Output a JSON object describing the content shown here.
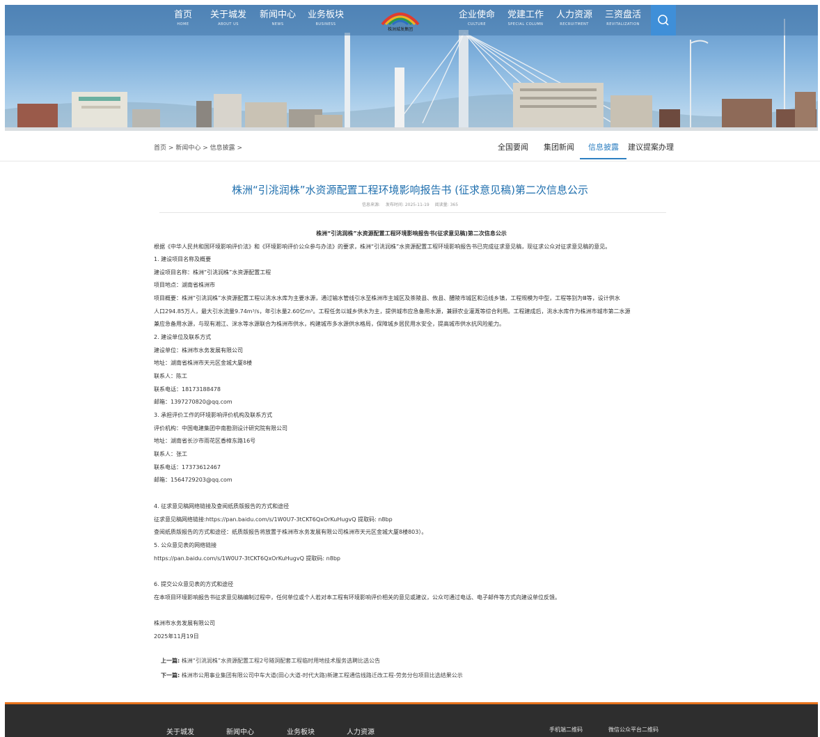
{
  "nav": {
    "items": [
      {
        "zh": "首页",
        "en": "HOME"
      },
      {
        "zh": "关于城发",
        "en": "ABOUT US"
      },
      {
        "zh": "新闻中心",
        "en": "NEWS"
      },
      {
        "zh": "业务板块",
        "en": "BUSINESS"
      },
      {
        "zh": "企业使命",
        "en": "CULTURE"
      },
      {
        "zh": "党建工作",
        "en": "SPECIAL COLUMN"
      },
      {
        "zh": "人力资源",
        "en": "RECRUITMENT"
      },
      {
        "zh": "三资盘活",
        "en": "REVITALIZATION"
      }
    ],
    "logo_text": "株洲城发集团"
  },
  "breadcrumb": {
    "home": "首页",
    "sep": ">",
    "news": "新闻中心",
    "current": "信息披露"
  },
  "tabs": [
    "全国要闻",
    "集团新闻",
    "信息披露",
    "建议提案办理"
  ],
  "article": {
    "title": "株洲“引洮润株”水资源配置工程环境影响报告书 (征求意见稿)第二次信息公示",
    "meta": {
      "source": "信息来源:",
      "date": "发布时间: 2025-11-19",
      "views": "阅读量: 365"
    },
    "heading": "株洲“引洮润株”水资源配置工程环境影响报告书(征求意见稿)第二次信息公示",
    "lines": [
      "根据《中华人民共和国环境影响评价法》和《环境影响评价公众参与办法》的要求，株洲“引洮润株”水资源配置工程环境影响报告书已完成征求意见稿，现征求公众对征求意见稿的意见。",
      "1. 建设项目名称及概要",
      "建设项目名称：株洲“引洮润株”水资源配置工程",
      "项目地点：湖南省株洲市",
      "项目概要：株洲“引洮润株”水资源配置工程以洮水水库为主要水源，通过输水管线引水至株洲市主城区及茶陵县、攸县、醴陵市城区和沿线乡镇，工程规模为中型，工程等别为Ⅲ等，设计供水",
      "人口294.85万人，最大引水流量9.74m³/s，年引水量2.60亿m³。工程任务以城乡供水为主，提供城市应急备用水源，兼顾农业灌溉等综合利用。工程建成后，洮水水库作为株洲市城市第二水源",
      "兼应急备用水源，与现有湘江、洣水等水源联合为株洲市供水，构建城市多水源供水格局，保障城乡居民用水安全，提高城市供水抗风险能力。",
      "2. 建设单位及联系方式",
      "建设单位：株洲市水务发展有限公司",
      "地址：湖南省株洲市天元区金城大厦8楼",
      "联系人：陈工",
      "联系电话：18173188478",
      "邮箱：1397270820@qq.com",
      "3. 承担评价工作的环境影响评价机构及联系方式",
      "评价机构：中国电建集团中南勘测设计研究院有限公司",
      "地址：湖南省长沙市雨花区香樟东路16号",
      "联系人：张工",
      "联系电话：17373612467",
      "邮箱：1564729203@qq.com",
      "4. 征求意见稿网络链接及查阅纸质版报告的方式和途径",
      "征求意见稿网络链接:https://pan.baidu.com/s/1W0U7-3tCKT6QxOrKuHugvQ 提取码: n8bp",
      "查阅纸质版报告的方式和途径：纸质版报告将放置于株洲市水务发展有限公司株洲市天元区金城大厦8楼803）。",
      "5. 公众意见表的网络链接",
      "https://pan.baidu.com/s/1W0U7-3tCKT6QxOrKuHugvQ 提取码: n8bp",
      "6. 提交公众意见表的方式和途径",
      "在本项目环境影响报告书征求意见稿编制过程中，任何单位或个人若对本工程有环境影响评价相关的意见或建议，公众可通过电话、电子邮件等方式向建设单位反馈。",
      "株洲市水务发展有限公司",
      "2025年11月19日"
    ],
    "prev_label": "上一篇:",
    "prev_text": "株洲“引洮润株”水资源配置工程2号隧洞配套工程临时用地技术服务选聘比选公告",
    "next_label": "下一篇:",
    "next_text": "株洲市公用事业集团有限公司中车大道(田心大道-时代大路)新建工程通信线路迁改工程-劳务分包项目比选结果公示"
  },
  "footer": {
    "links": [
      "关于城发",
      "新闻中心",
      "业务板块",
      "人力资源"
    ],
    "qr_mobile": "手机端二维码",
    "qr_wechat": "微信公众平台二维码"
  },
  "colors": {
    "accent": "#2d7fc1",
    "title": "#1f6fae",
    "footer_bg": "#2e2e2e",
    "footer_accent": "#e7731c",
    "search": "#3f8fd8"
  }
}
